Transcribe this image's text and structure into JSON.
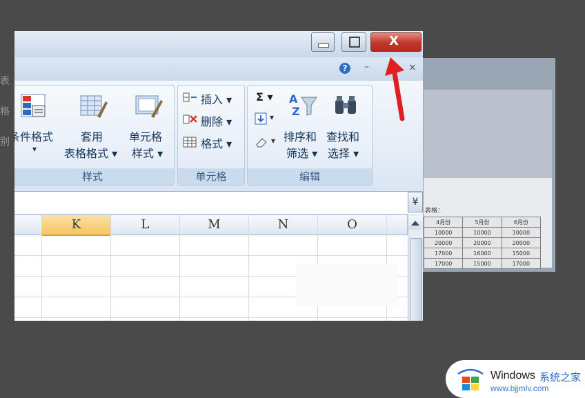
{
  "left_hint": [
    "表格",
    "别"
  ],
  "window": {
    "titlebar": {
      "close_label": "X"
    },
    "menubar": {
      "help": "?",
      "minimize": "–",
      "close": "×"
    }
  },
  "ribbon": {
    "groups": {
      "styles": {
        "label": "样式",
        "cond_format": [
          "条件格式",
          "▾"
        ],
        "table_format": [
          "套用",
          "表格格式 ▾"
        ],
        "cell_styles": [
          "单元格",
          "样式 ▾"
        ]
      },
      "cells": {
        "label": "单元格",
        "insert": "插入 ▾",
        "delete": "删除 ▾",
        "format": "格式 ▾"
      },
      "editing": {
        "label": "编辑",
        "sum_symbol": "Σ ▾",
        "fill_symbol": "▾",
        "clear_symbol": "▾",
        "sort": [
          "排序和",
          "筛选 ▾"
        ],
        "find": [
          "查找和",
          "选择 ▾"
        ]
      }
    }
  },
  "formula_bar": {
    "expand": "¥"
  },
  "grid": {
    "columns": [
      "K",
      "L",
      "M",
      "N",
      "O"
    ],
    "selected_column": "K"
  },
  "background_window": {
    "headers": [
      "4月份",
      "5月份",
      "6月份"
    ],
    "rows": [
      [
        "10000",
        "10000",
        "10000"
      ],
      [
        "20000",
        "20000",
        "20000"
      ],
      [
        "17000",
        "16000",
        "15000"
      ],
      [
        "17000",
        "15000",
        "17000"
      ]
    ],
    "partial_label": "表格："
  },
  "watermark": {
    "title": "Windows",
    "brand_cn": "系统之家",
    "url": "www.bjjmlv.com"
  },
  "colors": {
    "arrow": "#e02020",
    "selected_col": "#f4c560",
    "close_button": "#c0362a"
  }
}
